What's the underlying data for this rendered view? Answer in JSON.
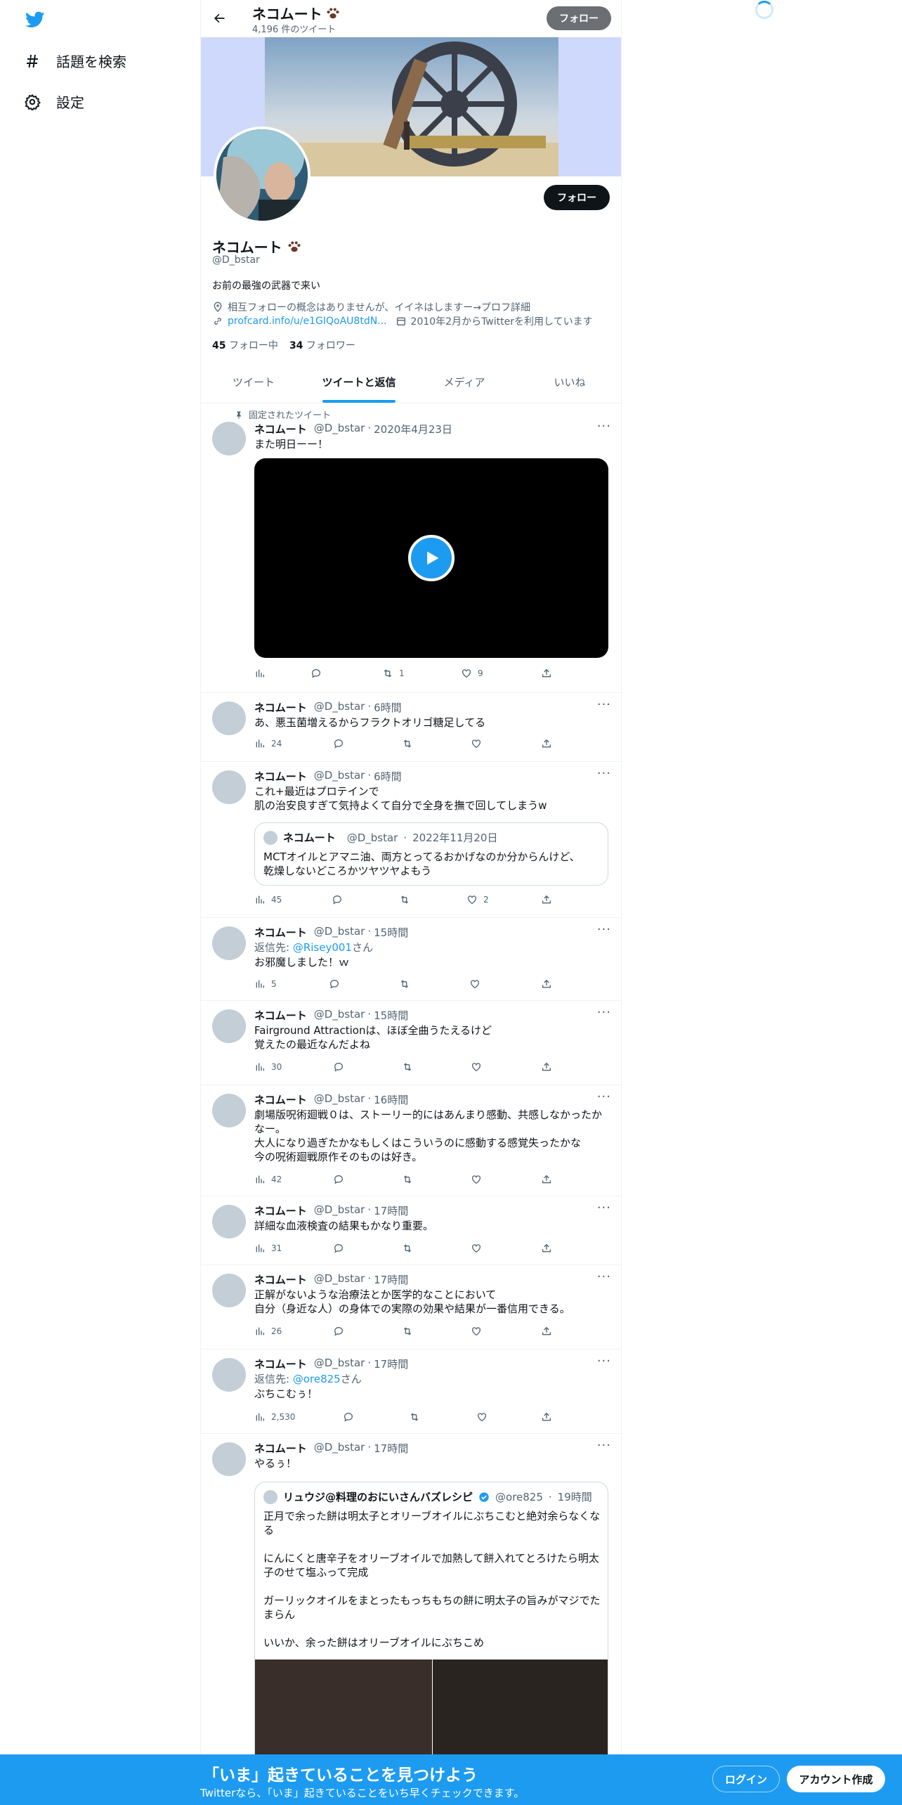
{
  "nav": {
    "explore": "話題を検索",
    "settings": "設定"
  },
  "topbar": {
    "name": "ネコムート",
    "tweet_count": "4,196 件のツイート",
    "follow": "フォロー"
  },
  "profile": {
    "name": "ネコムート",
    "handle": "@D_bstar",
    "bio": "お前の最強の武器で来い",
    "location": "相互フォローの概念はありませんが、イイネはしますー→プロフ詳細",
    "url": "profcard.info/u/e1GIQoAU8tdN...",
    "joined": "2010年2月からTwitterを利用しています",
    "following_count": "45",
    "following_label": "フォロー中",
    "followers_count": "34",
    "followers_label": "フォロワー",
    "follow_button": "フォロー"
  },
  "tabs": [
    "ツイート",
    "ツイートと返信",
    "メディア",
    "いいね"
  ],
  "tweets": [
    {
      "pinned_label": "固定されたツイート",
      "name": "ネコムート",
      "handle": "@D_bstar",
      "time": "2020年4月23日",
      "text": "また明日ーー！",
      "views": "",
      "retweets": "1",
      "likes": "9"
    },
    {
      "name": "ネコムート",
      "handle": "@D_bstar",
      "time": "6時間",
      "text": "あ、悪玉菌増えるからフラクトオリゴ糖足してる",
      "views": "24"
    },
    {
      "name": "ネコムート",
      "handle": "@D_bstar",
      "time": "6時間",
      "text1": "これ+最近はプロテインで",
      "text2": "肌の治安良すぎて気持よくて自分で全身を撫で回してしまうw",
      "views": "45",
      "likes": "2",
      "quote": {
        "name": "ネコムート",
        "handle": "@D_bstar",
        "time": "2022年11月20日",
        "text1": "MCTオイルとアマニ油、両方とってるおかげなのか分からんけど、",
        "text2": "乾燥しないどころかツヤツヤよもう"
      }
    },
    {
      "name": "ネコムート",
      "handle": "@D_bstar",
      "time": "15時間",
      "reply_prefix": "返信先: ",
      "reply_to": "@Risey001",
      "reply_suffix": "さん",
      "text": "お邪魔しました！ｗ",
      "views": "5"
    },
    {
      "name": "ネコムート",
      "handle": "@D_bstar",
      "time": "15時間",
      "text1": "Fairground Attractionは、ほぼ全曲うたえるけど",
      "text2": "覚えたの最近なんだよね",
      "views": "30"
    },
    {
      "name": "ネコムート",
      "handle": "@D_bstar",
      "time": "16時間",
      "text1": "劇場版呪術廻戦０は、ストーリー的にはあんまり感動、共感しなかったか",
      "text2": "なー。",
      "text3": "大人になり過ぎたかなもしくはこういうのに感動する感覚失ったかな",
      "text4": "今の呪術廻戦原作そのものは好き。",
      "views": "42"
    },
    {
      "name": "ネコムート",
      "handle": "@D_bstar",
      "time": "17時間",
      "text": "詳細な血液検査の結果もかなり重要。",
      "views": "31"
    },
    {
      "name": "ネコムート",
      "handle": "@D_bstar",
      "time": "17時間",
      "text1": "正解がないような治療法とか医学的なことにおいて",
      "text2": "自分（身近な人）の身体での実際の効果や結果が一番信用できる。",
      "views": "26"
    },
    {
      "name": "ネコムート",
      "handle": "@D_bstar",
      "time": "17時間",
      "reply_prefix": "返信先: ",
      "reply_to": "@ore825",
      "reply_suffix": "さん",
      "text": "ぶちこむぅ！",
      "views": "2,530"
    },
    {
      "name": "ネコムート",
      "handle": "@D_bstar",
      "time": "17時間",
      "text": "やるぅ！",
      "quote": {
        "name": "リュウジ@料理のおにいさんバズレシピ",
        "handle": "@ore825",
        "time": "19時間",
        "text1": "正月で余った餅は明太子とオリーブオイルにぶちこむと絶対余らなくなる",
        "text2": "にんにくと唐辛子をオリーブオイルで加熱して餅入れてとろけたら明太子のせて塩ふって完成",
        "text3": "ガーリックオイルをまとったもっちもちの餅に明太子の旨みがマジでたまらん",
        "text4": "いいか、余った餅はオリーブオイルにぶちこめ"
      }
    }
  ],
  "bottom": {
    "title": "「いま」起きていることを見つけよう",
    "subtitle": "Twitterなら、「いま」起きていることをいち早くチェックできます。",
    "login": "ログイン",
    "signup": "アカウント作成"
  },
  "colors": {
    "accent": "#1d9bf0",
    "text": "#0f1419",
    "muted": "#536471",
    "banner_bg": "#cfd9fb"
  }
}
